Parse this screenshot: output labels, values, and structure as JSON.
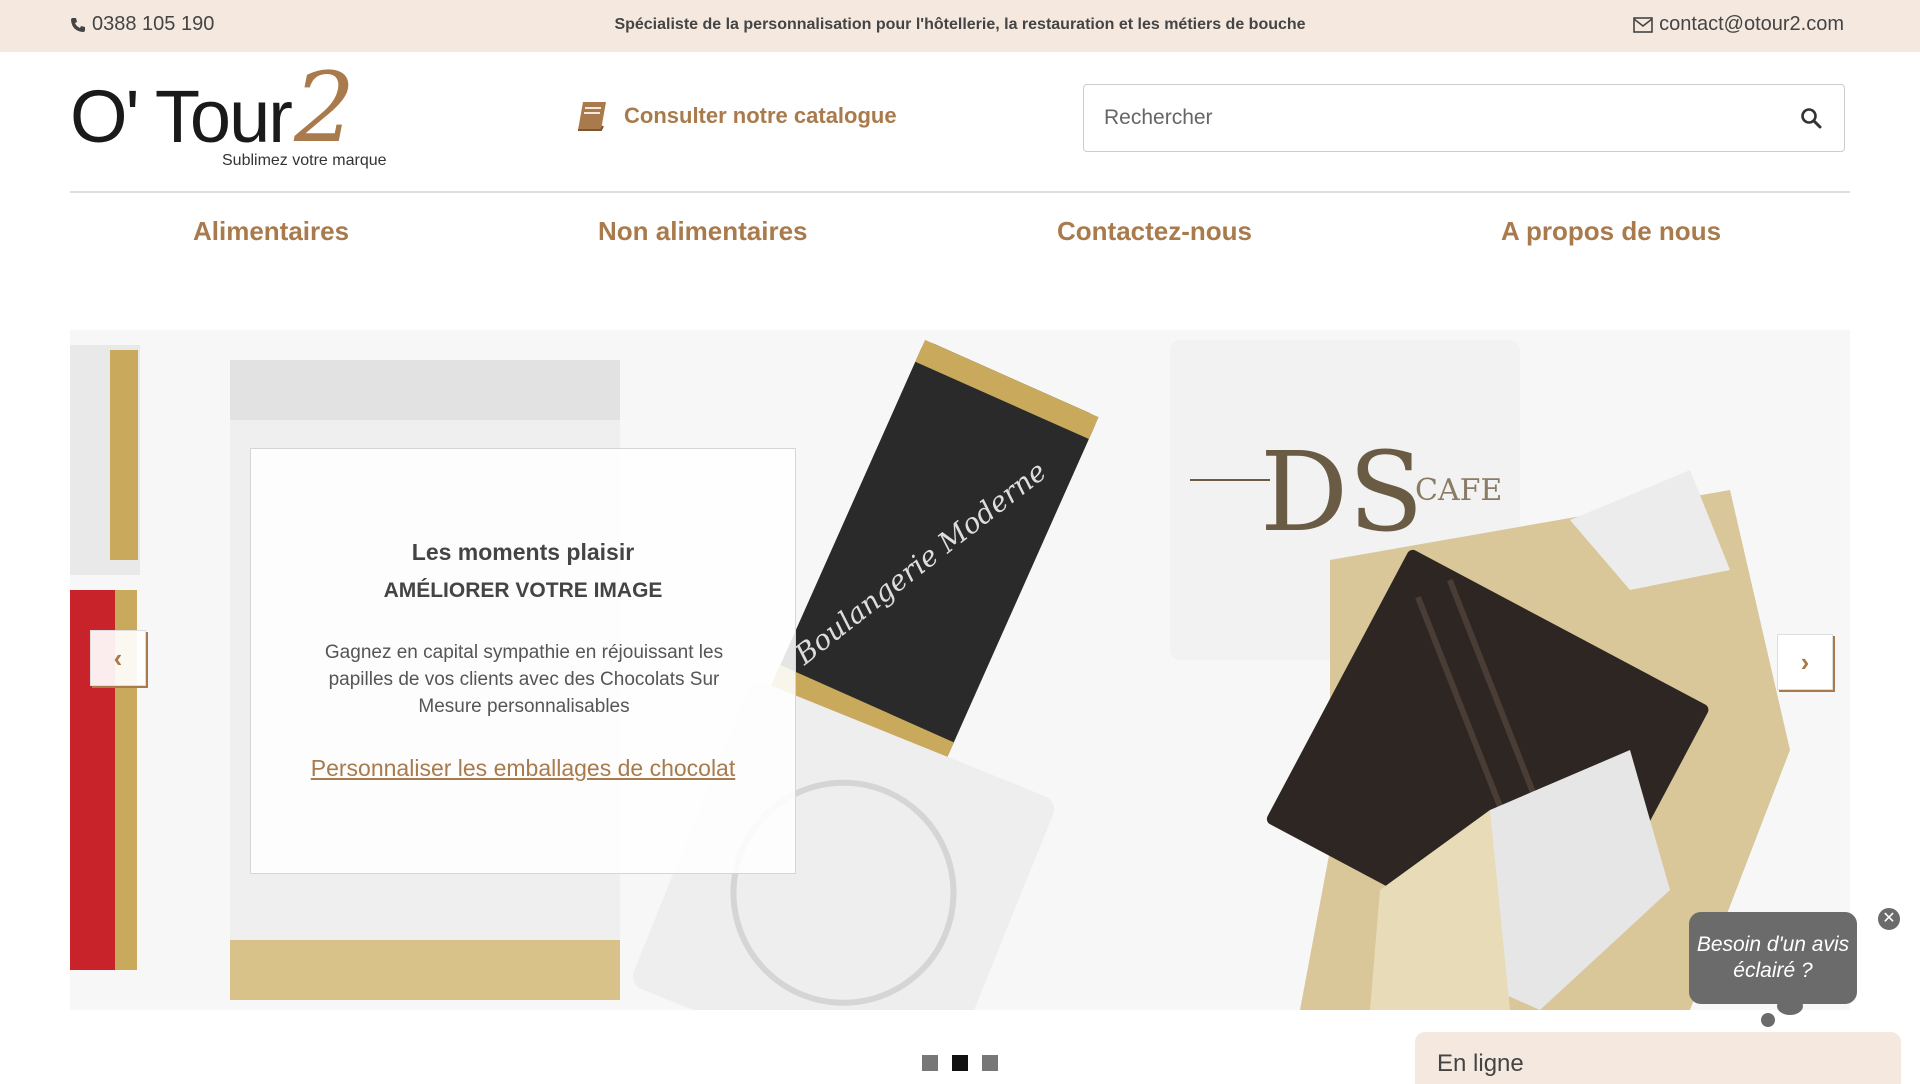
{
  "topbar": {
    "phone": "0388 105 190",
    "tagline": "Spécialiste de la personnalisation pour l'hôtellerie, la restauration et les métiers de bouche",
    "email": "contact@otour2.com"
  },
  "header": {
    "logo_text": "O' Tour",
    "logo_accent": "2",
    "logo_tagline": "Sublimez votre marque",
    "catalogue_label": "Consulter notre catalogue",
    "search_placeholder": "Rechercher"
  },
  "nav": {
    "items": [
      {
        "label": "Alimentaires"
      },
      {
        "label": "Non alimentaires"
      },
      {
        "label": "Contactez-nous"
      },
      {
        "label": "A propos de nous"
      }
    ]
  },
  "slider": {
    "caption_title": "Les moments plaisir",
    "caption_subtitle": "AMÉLIORER VOTRE IMAGE",
    "caption_text": "Gagnez en capital sympathie en réjouissant les papilles de vos clients avec des Chocolats Sur Mesure personnalisables",
    "caption_link": "Personnaliser les emballages de chocolat",
    "prev_label": "‹",
    "next_label": "›",
    "slide_count": 3,
    "active_slide": 2
  },
  "chat": {
    "bubble_text": "Besoin d'un avis éclairé ?",
    "close_label": "✕",
    "status_label": "En ligne"
  },
  "colors": {
    "accent": "#a97a4c",
    "topbar_bg": "#f5e9df",
    "chat_bubble": "#6b6b6b"
  }
}
